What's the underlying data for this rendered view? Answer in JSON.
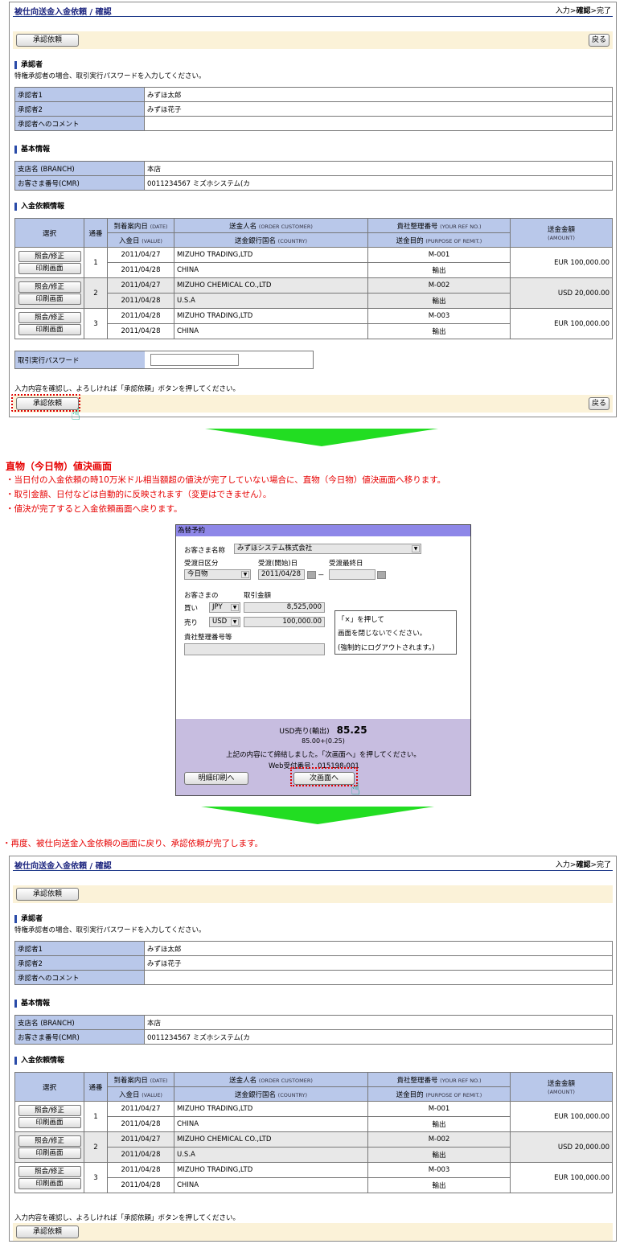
{
  "screen1": {
    "title": "被仕向送金入金依頼 / 確認",
    "steps_pre": "入力>",
    "steps_cur": "確認",
    "steps_post": ">完了",
    "approve_btn": "承認依頼",
    "back_btn": "戻る",
    "approver_section": "承認者",
    "approver_note": "特権承認者の場合、取引実行パスワードを入力してください。",
    "approver_rows": [
      {
        "label": "承認者1",
        "value": "みずほ太郎"
      },
      {
        "label": "承認者2",
        "value": "みずほ花子"
      },
      {
        "label": "承認者へのコメント",
        "value": ""
      }
    ],
    "basic_section": "基本情報",
    "basic_rows": [
      {
        "label": "支店名 (BRANCH)",
        "value": "本店"
      },
      {
        "label": "お客さま番号(CMR)",
        "value": "0011234567 ミズホシステム(カ"
      }
    ],
    "deposit_section": "入金依頼情報",
    "col_select": "選択",
    "col_no": "通番",
    "col_arrival": "到着案内日",
    "col_arrival_en": "(DATE)",
    "col_value": "入金日",
    "col_value_en": "(VALUE)",
    "col_sender": "送金人名",
    "col_sender_en": "(ORDER CUSTOMER)",
    "col_country": "送金銀行国名",
    "col_country_en": "(COUNTRY)",
    "col_ref": "貴社整理番号",
    "col_ref_en": "(YOUR REF NO.)",
    "col_purpose": "送金目的",
    "col_purpose_en": "(PURPOSE OF REMIT.)",
    "col_amount": "送金金額",
    "col_amount_en": "(AMOUNT)",
    "btn_edit": "照会/修正",
    "btn_print": "印刷画面",
    "rows": [
      {
        "no": "1",
        "arrival": "2011/04/27",
        "value": "2011/04/28",
        "sender": "MIZUHO TRADING,LTD",
        "country": "CHINA",
        "ref": "M-001",
        "purpose": "輸出",
        "amount": "EUR  100,000.00"
      },
      {
        "no": "2",
        "arrival": "2011/04/27",
        "value": "2011/04/28",
        "sender": "MIZUHO CHEMICAL CO.,LTD",
        "country": "U.S.A",
        "ref": "M-002",
        "purpose": "輸出",
        "amount": "USD  20,000.00"
      },
      {
        "no": "3",
        "arrival": "2011/04/28",
        "value": "2011/04/28",
        "sender": "MIZUHO TRADING,LTD",
        "country": "CHINA",
        "ref": "M-003",
        "purpose": "輸出",
        "amount": "EUR  100,000.00"
      }
    ],
    "password_label": "取引実行パスワード",
    "confirm_note": "入力内容を確認し、よろしければ「承認依頼」ボタンを押してください。"
  },
  "explain": {
    "heading": "直物（今日物）値決画面",
    "line1": "・当日付の入金依頼の時10万米ドル相当額超の値決が完了していない場合に、直物（今日物）値決画面へ移ります。",
    "line2": "・取引金額、日付などは自動的に反映されます（変更はできません）。",
    "line3": "・値決が完了すると入金依頼画面へ戻ります。",
    "line4": "・再度、被仕向送金入金依頼の画面に戻り、承認依頼が完了します。"
  },
  "fx": {
    "title": "為替予約",
    "customer_label": "お客さま名称",
    "customer_value": "みずほシステム株式会社",
    "delivery_type_label": "受渡日区分",
    "delivery_start_label": "受渡(開始)日",
    "delivery_end_label": "受渡最終日",
    "delivery_type_value": "今日物",
    "delivery_start_value": "2011/04/28",
    "dash": "－",
    "customer_side": "お客さまの",
    "trade_amount": "取引金額",
    "buy_label": "買い",
    "buy_ccy": "JPY",
    "buy_amount": "8,525,000",
    "sell_label": "売り",
    "sell_ccy": "USD",
    "sell_amount": "100,000.00",
    "ref_label": "貴社整理番号等",
    "warn1": "「×」を押して",
    "warn2": "画面を閉じないでください。",
    "warn3": "(強制的にログアウトされます。)",
    "rate_label": "USD売り(輸出)",
    "rate_value": "85.25",
    "rate_detail": "85.00+(0.25)",
    "concluded": "上記の内容にて締結しました。「次画面へ」を押してください。",
    "web_no": "Web受付番号：015198-001",
    "print_btn": "明細印刷へ",
    "next_btn": "次画面へ"
  }
}
